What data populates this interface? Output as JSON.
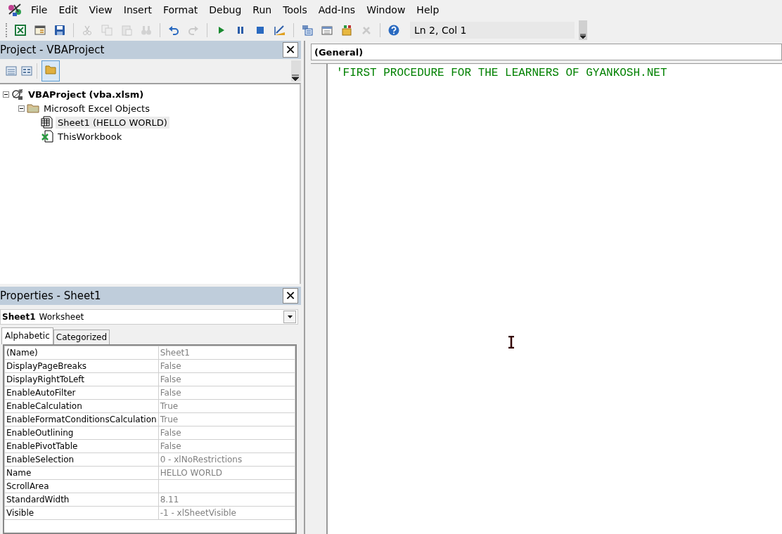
{
  "menu": [
    {
      "label": "File"
    },
    {
      "label": "Edit"
    },
    {
      "label": "View"
    },
    {
      "label": "Insert"
    },
    {
      "label": "Format"
    },
    {
      "label": "Debug"
    },
    {
      "label": "Run"
    },
    {
      "label": "Tools"
    },
    {
      "label": "Add-Ins"
    },
    {
      "label": "Window"
    },
    {
      "label": "Help"
    }
  ],
  "toolbar": {
    "buttons": [
      {
        "kind": "excel",
        "disabled": false
      },
      {
        "kind": "form",
        "disabled": false
      },
      {
        "kind": "save",
        "disabled": false
      },
      {
        "kind": "sep"
      },
      {
        "kind": "cut",
        "disabled": true
      },
      {
        "kind": "copy",
        "disabled": true
      },
      {
        "kind": "paste",
        "disabled": true
      },
      {
        "kind": "find",
        "disabled": true
      },
      {
        "kind": "sep"
      },
      {
        "kind": "undo",
        "disabled": false
      },
      {
        "kind": "redo",
        "disabled": true
      },
      {
        "kind": "sep"
      },
      {
        "kind": "run",
        "disabled": false
      },
      {
        "kind": "pause",
        "disabled": false
      },
      {
        "kind": "stop",
        "disabled": false
      },
      {
        "kind": "design",
        "disabled": false
      },
      {
        "kind": "sep"
      },
      {
        "kind": "explorer",
        "disabled": false
      },
      {
        "kind": "properties",
        "disabled": false
      },
      {
        "kind": "browser",
        "disabled": false
      },
      {
        "kind": "tools",
        "disabled": true
      },
      {
        "kind": "sep"
      },
      {
        "kind": "help",
        "disabled": false
      }
    ],
    "position": "Ln 2, Col 1"
  },
  "project": {
    "title": "Project - VBAProject",
    "close": "✕",
    "tree": [
      {
        "label": "VBAProject (vba.xlsm)",
        "kind": "project",
        "expanded": true,
        "selected": false,
        "children": [
          {
            "label": "Microsoft Excel Objects",
            "kind": "folder",
            "expanded": true,
            "selected": false,
            "children": [
              {
                "label": "Sheet1 (HELLO WORLD)",
                "kind": "sheet",
                "selected": true
              },
              {
                "label": "ThisWorkbook",
                "kind": "workbook",
                "selected": false
              }
            ]
          }
        ]
      }
    ]
  },
  "properties": {
    "title": "Properties - Sheet1",
    "close": "✕",
    "object_name": "Sheet1",
    "object_type": "Worksheet",
    "tabs": [
      {
        "label": "Alphabetic",
        "selected": true
      },
      {
        "label": "Categorized",
        "selected": false
      }
    ],
    "rows": [
      {
        "name": "(Name)",
        "value": "Sheet1"
      },
      {
        "name": "DisplayPageBreaks",
        "value": "False"
      },
      {
        "name": "DisplayRightToLeft",
        "value": "False"
      },
      {
        "name": "EnableAutoFilter",
        "value": "False"
      },
      {
        "name": "EnableCalculation",
        "value": "True"
      },
      {
        "name": "EnableFormatConditionsCalculation",
        "value": "True"
      },
      {
        "name": "EnableOutlining",
        "value": "False"
      },
      {
        "name": "EnablePivotTable",
        "value": "False"
      },
      {
        "name": "EnableSelection",
        "value": "0 - xlNoRestrictions"
      },
      {
        "name": "Name",
        "value": "HELLO WORLD"
      },
      {
        "name": "ScrollArea",
        "value": ""
      },
      {
        "name": "StandardWidth",
        "value": "8.11"
      },
      {
        "name": "Visible",
        "value": "-1 - xlSheetVisible"
      }
    ]
  },
  "code": {
    "object": "(General)",
    "lines": [
      {
        "text": "'FIRST PROCEDURE FOR THE LEARNERS OF GYANKOSH.NET",
        "kind": "comment"
      }
    ]
  }
}
